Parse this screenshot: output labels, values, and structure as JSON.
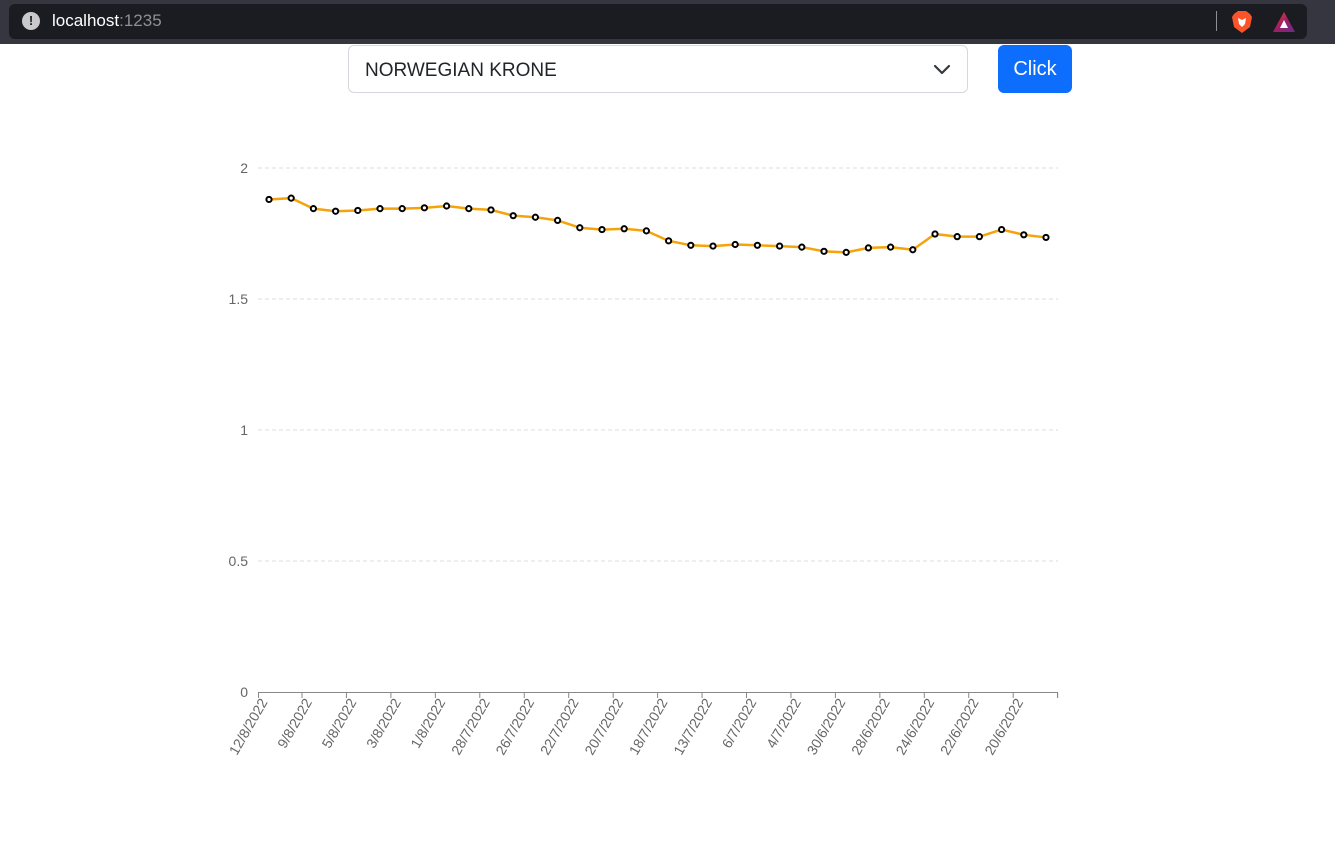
{
  "browser": {
    "url_host": "localhost",
    "url_port": ":1235",
    "icons": [
      "info-icon",
      "brave-shield-icon",
      "brave-rewards-icon"
    ]
  },
  "controls": {
    "currency_selected": "NORWEGIAN KRONE",
    "submit_label": "Click",
    "accent_color": "#0d6efd"
  },
  "chart_data": {
    "type": "line",
    "title": "",
    "xlabel": "",
    "ylabel": "",
    "ylim": [
      0,
      2
    ],
    "y_ticks": [
      "0",
      "0.5",
      "1",
      "1.5",
      "2"
    ],
    "grid": true,
    "line_color": "#f5a30b",
    "marker_color": "#000000",
    "x": [
      "12/8/2022",
      "11/8/2022",
      "9/8/2022",
      "8/8/2022",
      "5/8/2022",
      "4/8/2022",
      "3/8/2022",
      "2/8/2022",
      "1/8/2022",
      "29/7/2022",
      "28/7/2022",
      "27/7/2022",
      "26/7/2022",
      "25/7/2022",
      "22/7/2022",
      "21/7/2022",
      "20/7/2022",
      "19/7/2022",
      "18/7/2022",
      "15/7/2022",
      "13/7/2022",
      "8/7/2022",
      "6/7/2022",
      "5/7/2022",
      "4/7/2022",
      "1/7/2022",
      "30/6/2022",
      "29/6/2022",
      "28/6/2022",
      "27/6/2022",
      "24/6/2022",
      "23/6/2022",
      "22/6/2022",
      "21/6/2022",
      "20/6/2022",
      "17/6/2022"
    ],
    "x_tick_labels": [
      "12/8/2022",
      "9/8/2022",
      "5/8/2022",
      "3/8/2022",
      "1/8/2022",
      "28/7/2022",
      "26/7/2022",
      "22/7/2022",
      "20/7/2022",
      "18/7/2022",
      "13/7/2022",
      "6/7/2022",
      "4/7/2022",
      "30/6/2022",
      "28/6/2022",
      "24/6/2022",
      "22/6/2022",
      "20/6/2022"
    ],
    "series": [
      {
        "values": [
          1.88,
          1.885,
          1.845,
          1.835,
          1.838,
          1.845,
          1.845,
          1.848,
          1.855,
          1.845,
          1.84,
          1.818,
          1.812,
          1.8,
          1.772,
          1.765,
          1.768,
          1.76,
          1.722,
          1.705,
          1.702,
          1.708,
          1.705,
          1.702,
          1.698,
          1.682,
          1.678,
          1.695,
          1.698,
          1.688,
          1.748,
          1.738,
          1.738,
          1.765,
          1.745,
          1.735
        ]
      }
    ]
  }
}
